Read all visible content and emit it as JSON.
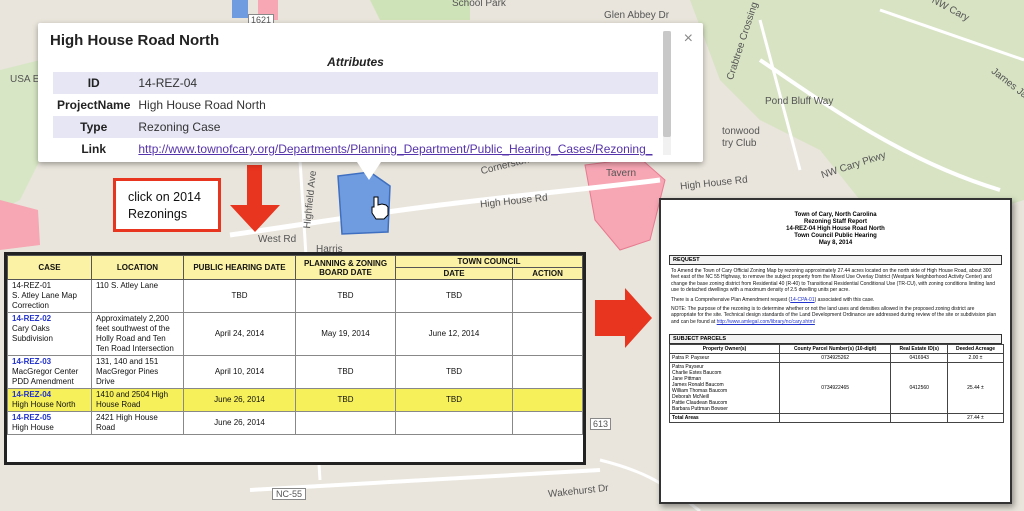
{
  "popup": {
    "title": "High House Road North",
    "attributes_heading": "Attributes",
    "rows": [
      {
        "key": "ID",
        "value": "14-REZ-04"
      },
      {
        "key": "ProjectName",
        "value": "High House Road North"
      },
      {
        "key": "Type",
        "value": "Rezoning Case"
      },
      {
        "key": "Link",
        "value": "http://www.townofcary.org/Departments/Planning_Department/Public_Hearing_Cases/Rezoning_"
      }
    ],
    "close": "×"
  },
  "callout": {
    "line1": "click on 2014",
    "line2": "Rezonings"
  },
  "map_labels": {
    "school_park": "School Park",
    "glen_abbey": "Glen Abbey Dr",
    "nw_cary": "NW Cary",
    "crabtree": "Crabtree Crossing Pkwy",
    "pond_bluff": "Pond Bluff Way",
    "james": "James Jackson",
    "tonwood": "tonwood",
    "try_club": "try Club",
    "nw_cary_pkwy": "NW Cary Pkwy",
    "cornerstone": "Cornerstone Dr",
    "tavern": "Tavern",
    "high_house_rd1": "High House Rd",
    "high_house_rd2": "High House Rd",
    "highfield": "Highfield Ave",
    "west_rd": "West Rd",
    "harris": "Harris",
    "usa": "USA E",
    "route_1621": "1621",
    "route_613": "613",
    "nc55": "NC-55",
    "wakehurst": "Wakehurst Dr"
  },
  "schedule": {
    "headers": {
      "case": "CASE",
      "location": "LOCATION",
      "public_hearing": "PUBLIC HEARING DATE",
      "planning_zoning": "PLANNING & ZONING BOARD DATE",
      "town_council": "TOWN COUNCIL",
      "date": "DATE",
      "action": "ACTION"
    },
    "rows": [
      {
        "case": "14-REZ-01",
        "case_desc": "S. Atley Lane Map Correction",
        "location": "110 S. Atley Lane",
        "hearing": "TBD",
        "pz": "TBD",
        "tc_date": "TBD",
        "action": ""
      },
      {
        "case": "14-REZ-02",
        "case_desc": "Cary Oaks Subdivision",
        "location": "Approximately 2,200 feet southwest of the Holly Road and Ten Ten Road Intersection",
        "hearing": "April 24, 2014",
        "pz": "May 19, 2014",
        "tc_date": "June 12, 2014",
        "action": ""
      },
      {
        "case": "14-REZ-03",
        "case_desc": "MacGregor Center PDD Amendment",
        "location": "131, 140 and 151 MacGregor Pines Drive",
        "hearing": "April 10, 2014",
        "pz": "TBD",
        "tc_date": "TBD",
        "action": ""
      },
      {
        "case": "14-REZ-04",
        "case_desc": "High House North",
        "location": "1410 and 2504 High House Road",
        "hearing": "June 26, 2014",
        "pz": "TBD",
        "tc_date": "TBD",
        "action": ""
      },
      {
        "case": "14-REZ-05",
        "case_desc": "High House",
        "location": "2421 High House Road",
        "hearing": "June 26, 2014",
        "pz": "",
        "tc_date": "",
        "action": ""
      }
    ]
  },
  "report": {
    "head1": "Town of Cary, North Carolina",
    "head2": "Rezoning Staff Report",
    "head3": "14-REZ-04 High House Road North",
    "head4": "Town Council Public Hearing",
    "head5": "May 8, 2014",
    "request_heading": "REQUEST",
    "request_text": "To Amend the Town of Cary Official Zoning Map by rezoning approximately 27.44 acres located on the north side of High House Road, about 300 feet east of the NC 55 Highway, to remove the subject property from the Mixed Use Overlay District (Westpark Neighborhood Activity Center) and change the base zoning district from Residential 40 (R-40) to Transitional Residential Conditional Use (TR-CU), with zoning conditions limiting land use to detached dwellings with a maximum density of 2.5 dwelling units per acre.",
    "cpa_text_pre": "There is a Comprehensive Plan Amendment request (",
    "cpa_link": "14-CPA-01",
    "cpa_text_post": ") associated with this case.",
    "note_text": "NOTE: The purpose of the rezoning is to determine whether or not the land uses and densities allowed in the proposed zoning district are appropriate for the site. Technical design standards of the Land Development Ordinance are addressed during review of the site or subdivision plan and can be found at",
    "note_link": "http://www.amlegal.com/library/nc/cary.shtml",
    "parcels_heading": "SUBJECT PARCELS",
    "parcel_headers": {
      "owner": "Property Owner(s)",
      "county": "County Parcel Number(s) (10-digit)",
      "real": "Real Estate ID(s)",
      "acreage": "Deeded Acreage"
    },
    "parcel_rows": [
      {
        "owner": "Patra P. Payseur",
        "county": "0734925262",
        "real": "0416943",
        "acreage": "2.00 ±"
      },
      {
        "owner": "Patra Payseur\nCharlie Estes Baucom\nJane Pittman\nJames Ronald Baucom\nWilliam Thomas Baucom\nDeborah McNeill\nPattie Claudean Baucom\nBarbara Puttman Bowser",
        "county": "0734922465",
        "real": "0412560",
        "acreage": "25.44 ±"
      }
    ],
    "total_label": "Total Areas",
    "total_value": "27.44 ±"
  },
  "colors": {
    "accent_red": "#e8351f",
    "parcel_blue": "#6f9ce0",
    "highlight_yellow": "#f6f05a",
    "pink_zone": "#f7a6b4"
  }
}
